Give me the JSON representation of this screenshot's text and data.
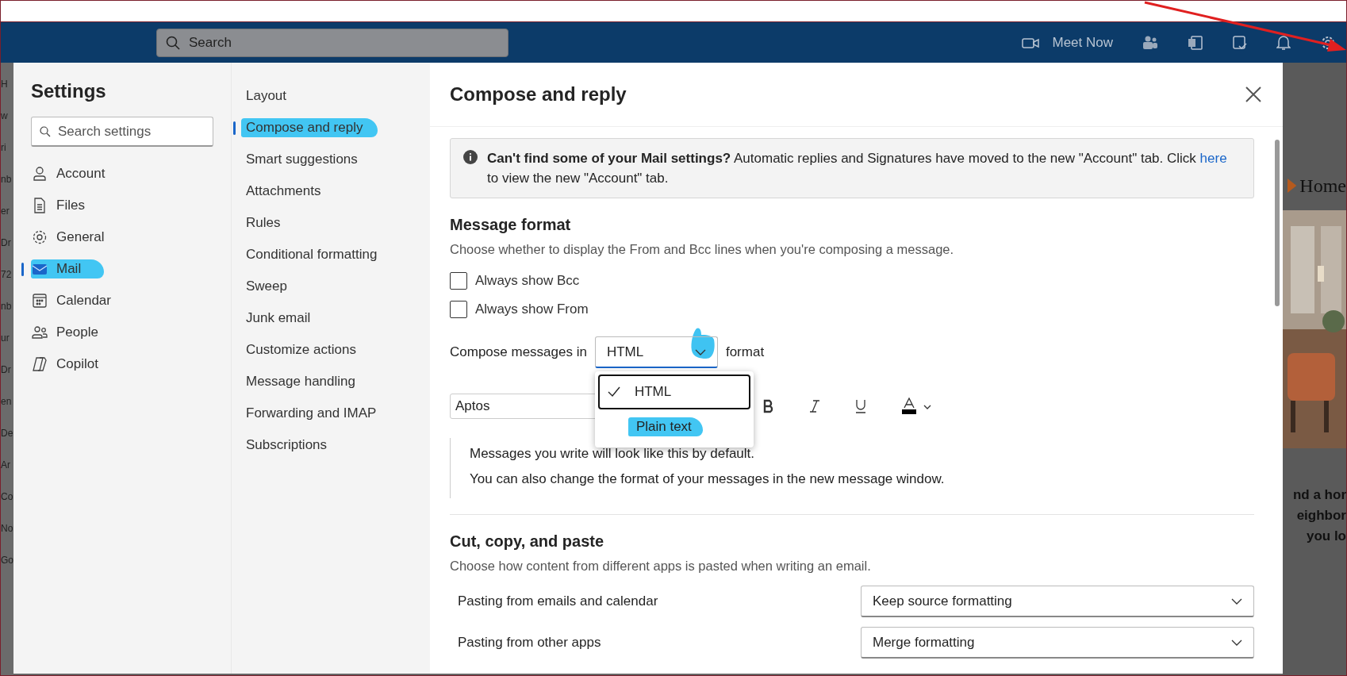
{
  "top_bar": {
    "search": {
      "placeholder": "Search"
    },
    "meet_now": "Meet Now"
  },
  "background": {
    "left_fragments": [
      "H",
      "w",
      "ri",
      "nb",
      "er",
      "Dr",
      "72",
      "nb",
      "ur",
      "Dr",
      "en",
      "De",
      "Ar",
      "Co",
      "No",
      "Go"
    ],
    "brand": "Home",
    "teaser": [
      "nd a hor",
      "eighbor",
      "you lo"
    ]
  },
  "settings": {
    "title": "Settings",
    "search": {
      "placeholder": "Search settings"
    },
    "categories": [
      {
        "label": "Account",
        "kind": "person",
        "selected": false,
        "highlighted": false
      },
      {
        "label": "Files",
        "kind": "file",
        "selected": false,
        "highlighted": false
      },
      {
        "label": "General",
        "kind": "gear",
        "selected": false,
        "highlighted": false
      },
      {
        "label": "Mail",
        "kind": "mail",
        "selected": true,
        "highlighted": true
      },
      {
        "label": "Calendar",
        "kind": "calendar",
        "selected": false,
        "highlighted": false
      },
      {
        "label": "People",
        "kind": "people",
        "selected": false,
        "highlighted": false
      },
      {
        "label": "Copilot",
        "kind": "copilot",
        "selected": false,
        "highlighted": false
      }
    ],
    "subcategories": [
      {
        "label": "Layout",
        "selected": false,
        "highlighted": false
      },
      {
        "label": "Compose and reply",
        "selected": true,
        "highlighted": true
      },
      {
        "label": "Smart suggestions",
        "selected": false,
        "highlighted": false
      },
      {
        "label": "Attachments",
        "selected": false,
        "highlighted": false
      },
      {
        "label": "Rules",
        "selected": false,
        "highlighted": false
      },
      {
        "label": "Conditional formatting",
        "selected": false,
        "highlighted": false
      },
      {
        "label": "Sweep",
        "selected": false,
        "highlighted": false
      },
      {
        "label": "Junk email",
        "selected": false,
        "highlighted": false
      },
      {
        "label": "Customize actions",
        "selected": false,
        "highlighted": false
      },
      {
        "label": "Message handling",
        "selected": false,
        "highlighted": false
      },
      {
        "label": "Forwarding and IMAP",
        "selected": false,
        "highlighted": false
      },
      {
        "label": "Subscriptions",
        "selected": false,
        "highlighted": false
      }
    ]
  },
  "panel": {
    "title": "Compose and reply",
    "notice": {
      "text": "**Can't find some of your Mail settings?** Automatic replies and Signatures have moved to the new \"Account\" tab. Click",
      "link": "here",
      "text_after": "to view the new \"Account\" tab."
    },
    "message_format": {
      "title": "Message format",
      "description": "Choose whether to display the From and Bcc lines when you're composing a message.",
      "checkboxes": [
        {
          "label": "Always show Bcc",
          "checked": false
        },
        {
          "label": "Always show From",
          "checked": false
        }
      ],
      "compose_label": "Compose messages in",
      "compose_value": "HTML",
      "compose_suffix": "format",
      "options": [
        {
          "label": "HTML",
          "selected": true,
          "highlighted": false
        },
        {
          "label": "Plain text",
          "selected": false,
          "highlighted": true
        }
      ],
      "font": "Aptos",
      "preview": [
        "Messages you write will look like this by default.",
        "You can also change the format of your messages in the new message window."
      ]
    },
    "cut_copy_paste": {
      "title": "Cut, copy, and paste",
      "description": "Choose how content from different apps is pasted when writing an email.",
      "rows": [
        {
          "label": "Pasting from emails and calendar",
          "value": "Keep source formatting"
        },
        {
          "label": "Pasting from other apps",
          "value": "Merge formatting"
        }
      ]
    }
  }
}
